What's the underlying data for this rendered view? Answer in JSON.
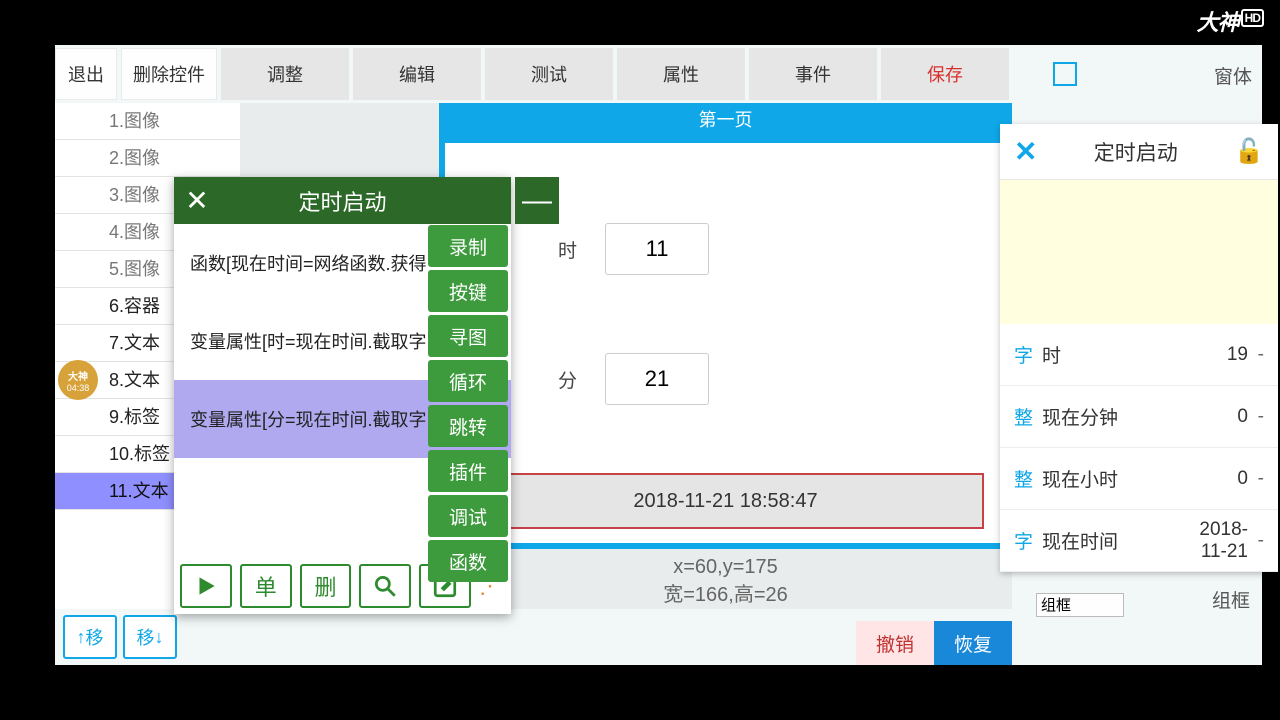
{
  "toolbar": {
    "exit": "退出",
    "delete_ctrl": "删除控件",
    "adjust": "调整",
    "edit": "编辑",
    "test": "测试",
    "attrs": "属性",
    "events": "事件",
    "save": "保存",
    "tab_form": "窗体",
    "tab_group": "组框",
    "combo_group": "组框"
  },
  "tree": {
    "items": [
      {
        "label": "1.图像",
        "dim": true
      },
      {
        "label": "2.图像",
        "dim": true
      },
      {
        "label": "3.图像",
        "dim": true
      },
      {
        "label": "4.图像",
        "dim": true
      },
      {
        "label": "5.图像",
        "dim": true
      },
      {
        "label": "6.容器"
      },
      {
        "label": "7.文本"
      },
      {
        "label": "8.文本"
      },
      {
        "label": "9.标签"
      },
      {
        "label": "10.标签"
      },
      {
        "label": "11.文本",
        "selected": true
      }
    ]
  },
  "canvas": {
    "page_title": "第一页",
    "row1_label": "时",
    "row1_value": "11",
    "row2_label": "分",
    "row2_value": "21",
    "datetime": "2018-11-21 18:58:47",
    "status1": "x=60,y=175",
    "status2": "宽=166,高=26"
  },
  "bottom": {
    "move_up": "移",
    "move_down": "移",
    "single": "单",
    "delete": "删",
    "undo": "撤销",
    "redo": "恢复"
  },
  "script": {
    "title": "定时启动",
    "lines": [
      "函数[现在时间=网络函数.获得",
      "变量属性[时=现在时间.截取字",
      "变量属性[分=现在时间.截取字"
    ],
    "selected_index": 2
  },
  "actions": {
    "record": "录制",
    "key": "按键",
    "find_img": "寻图",
    "loop": "循环",
    "jump": "跳转",
    "plugin": "插件",
    "debug": "调试",
    "func": "函数"
  },
  "props": {
    "title": "定时启动",
    "rows": [
      {
        "type": "字",
        "name": "时",
        "value": "19"
      },
      {
        "type": "整",
        "name": "现在分钟",
        "value": "0"
      },
      {
        "type": "整",
        "name": "现在小时",
        "value": "0"
      },
      {
        "type": "字",
        "name": "现在时间",
        "value": "2018-11-21"
      }
    ]
  },
  "badge": {
    "time": "04:38"
  },
  "logo": {
    "text": "大神",
    "hd": "HD"
  }
}
